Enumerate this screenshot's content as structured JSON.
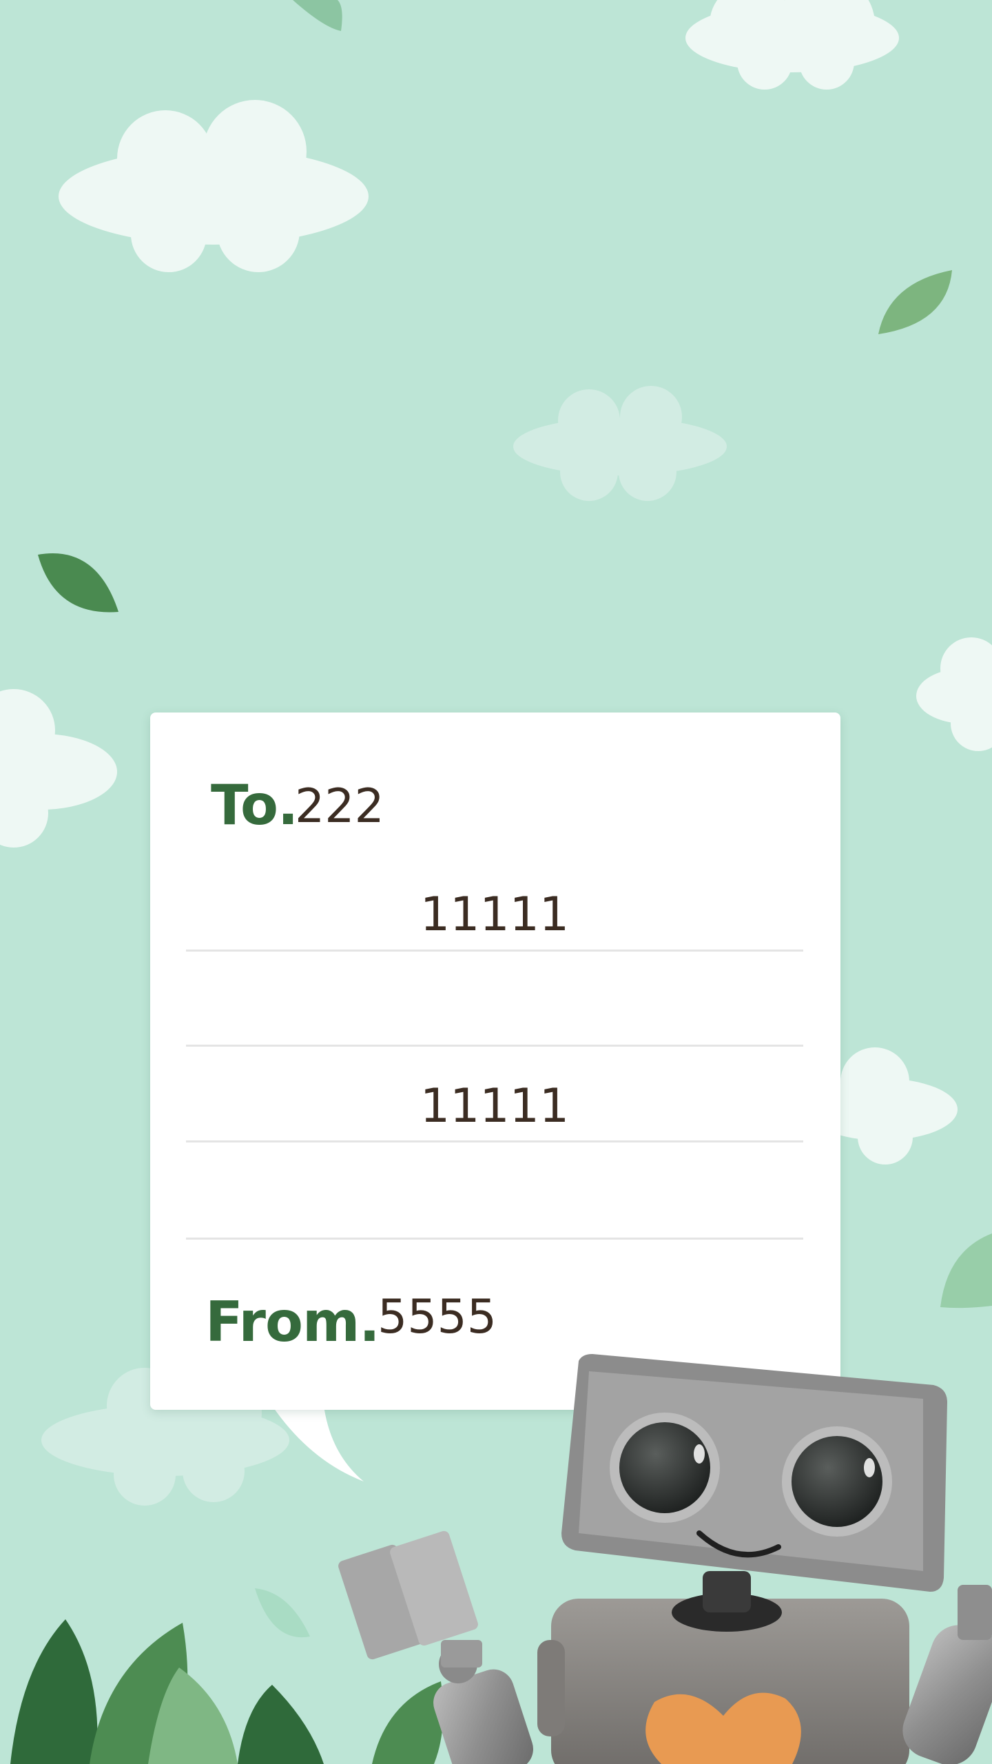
{
  "letter": {
    "to_label": "To.",
    "to_value": "222",
    "lines": [
      "11111",
      "",
      "11111",
      ""
    ],
    "from_label": "From.",
    "from_value": "5555"
  },
  "colors": {
    "background": "#bde5d6",
    "card": "#ffffff",
    "label_green": "#356a3c",
    "text_brown": "#3b2c22",
    "rule_line": "#e4e4e4"
  },
  "decorations": [
    "cloud-icon",
    "leaf-icon",
    "robot-illustration",
    "heart-icon",
    "bush-icon"
  ]
}
